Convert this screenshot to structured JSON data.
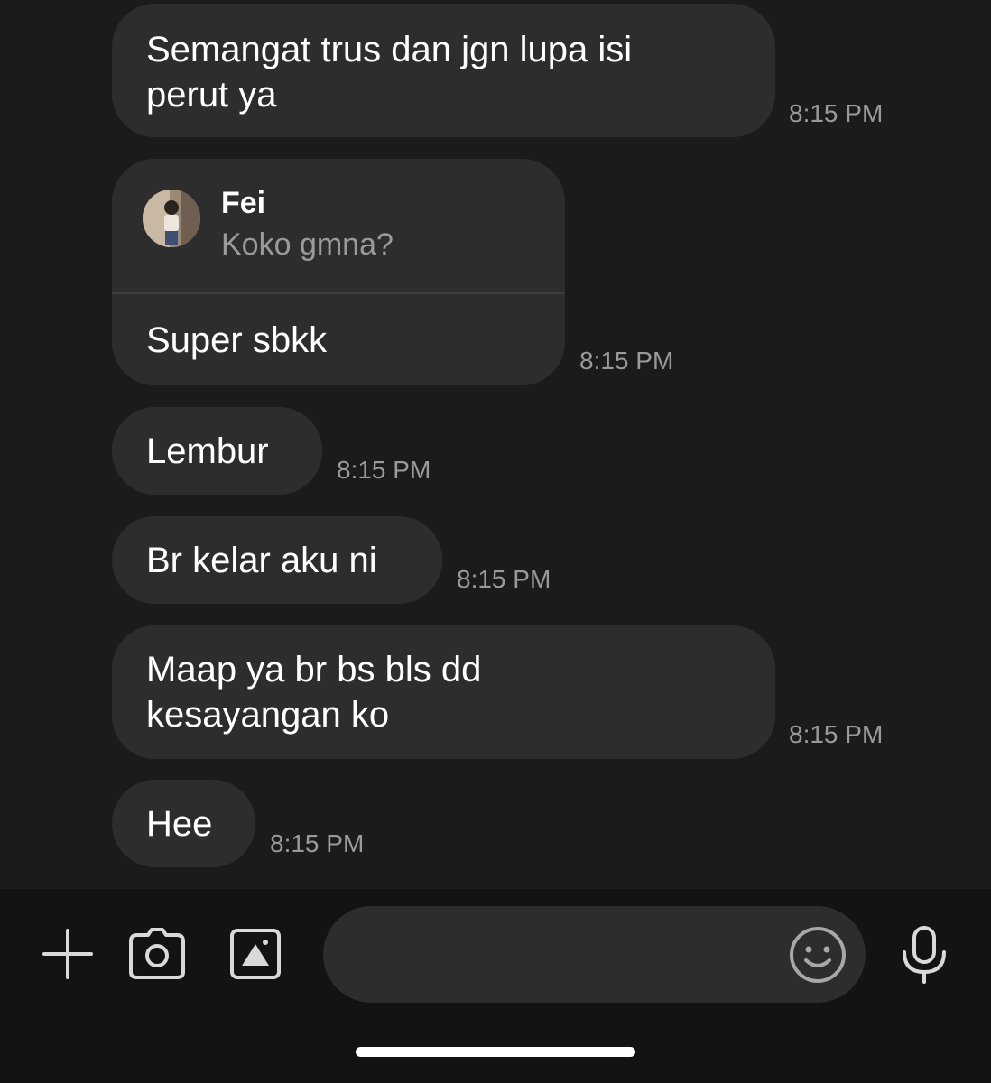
{
  "messages": [
    {
      "text_lines": [
        "Semangat trus dan jgn lupa isi",
        "perut ya"
      ],
      "time": "8:15 PM"
    },
    {
      "reply": {
        "name": "Fei",
        "preview": "Koko gmna?"
      },
      "text": "Super sbkk",
      "time": "8:15 PM"
    },
    {
      "text": "Lembur",
      "time": "8:15 PM"
    },
    {
      "text": "Br kelar aku ni",
      "time": "8:15 PM"
    },
    {
      "text_lines": [
        "Maap ya br bs bls dd",
        "kesayangan ko"
      ],
      "time": "8:15 PM"
    },
    {
      "text": "Hee",
      "time": "8:15 PM"
    }
  ],
  "input_bar": {
    "icons": [
      "plus-icon",
      "camera-icon",
      "gallery-icon",
      "emoji-icon",
      "microphone-icon"
    ],
    "message_placeholder": ""
  },
  "colors": {
    "background": "#1b1b1b",
    "bubble": "#2d2d2d",
    "input_bar": "#131313",
    "timestamp": "#9a9a9a",
    "icon": "#d9d9d9"
  }
}
